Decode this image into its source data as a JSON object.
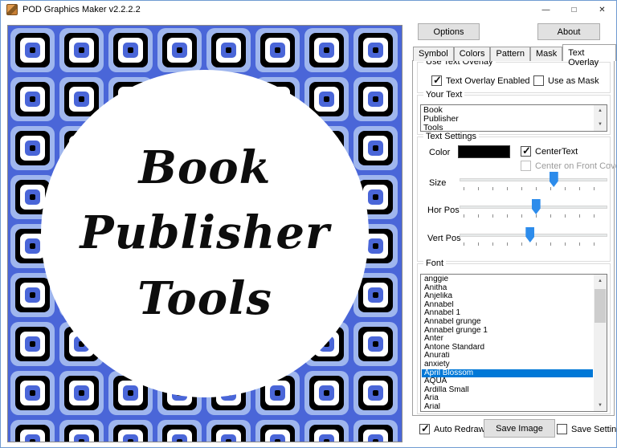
{
  "window": {
    "title": "POD Graphics Maker v2.2.2.2",
    "minimize_glyph": "—",
    "maximize_glyph": "□",
    "close_glyph": "✕"
  },
  "toolbar": {
    "options": "Options",
    "about": "About"
  },
  "tabs": {
    "items": [
      "Symbol",
      "Colors",
      "Pattern",
      "Mask",
      "Text Overlay"
    ],
    "active": "Text Overlay"
  },
  "use_text_overlay": {
    "title": "Use Text Overlay",
    "enabled_label": "Text Overlay Enabled",
    "enabled_checked": true,
    "mask_label": "Use as Mask",
    "mask_checked": false
  },
  "your_text": {
    "title": "Your Text",
    "lines": [
      "Book",
      "Publisher",
      "Tools"
    ]
  },
  "text_settings": {
    "title": "Text Settings",
    "color_label": "Color",
    "color_value": "#000000",
    "center_text_label": "CenterText",
    "center_text_checked": true,
    "center_front_label": "Center on Front Cover",
    "center_front_checked": false,
    "slider_thumb_color": "#2d8ceb",
    "sliders": [
      {
        "label": "Size",
        "value": 64
      },
      {
        "label": "Hor Pos",
        "value": 52
      },
      {
        "label": "Vert Pos",
        "value": 48
      }
    ]
  },
  "font": {
    "title": "Font",
    "items": [
      "anggie",
      "Anitha",
      "Anjelika",
      "Annabel",
      "Annabel 1",
      "Annabel grunge",
      "Annabel grunge 1",
      "Anter",
      "Antone Standard",
      "Anurati",
      "anxiety",
      "April Blossom",
      "AQUA",
      "Ardilla Small",
      "Aria",
      "Arial"
    ],
    "selected": "April Blossom",
    "selection_color": "#0078d7"
  },
  "footer": {
    "auto_redraw_label": "Auto Redraw",
    "auto_redraw_checked": true,
    "save_image_label": "Save Image",
    "save_settings_label": "Save Settings",
    "save_settings_checked": false
  },
  "preview": {
    "text_lines": [
      "Book",
      "Publisher",
      "Tools"
    ],
    "text_color": "#0d0d0d",
    "pattern_colors": [
      "#4a66d8",
      "#000000",
      "#9fb6ee",
      "#ffffff"
    ]
  }
}
